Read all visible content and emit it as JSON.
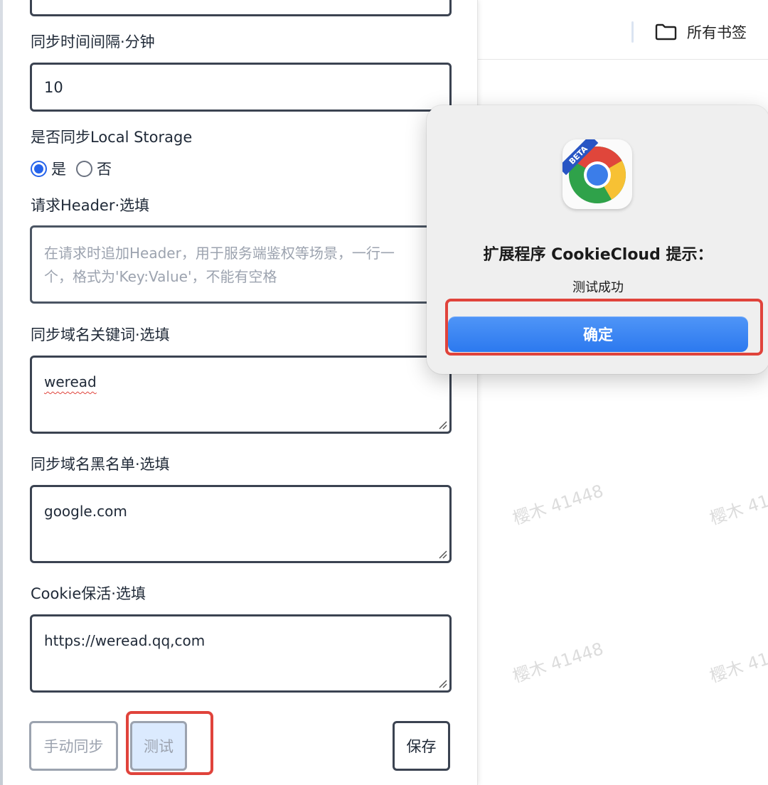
{
  "browser": {
    "bookmark_folder": "所有书签",
    "watermark_text": "樱木 41448"
  },
  "form": {
    "interval_label": "同步时间间隔·分钟",
    "interval_value": "10",
    "local_storage_label": "是否同步Local Storage",
    "local_storage_options": [
      {
        "label": "是",
        "checked": true
      },
      {
        "label": "否",
        "checked": false
      }
    ],
    "header_label": "请求Header·选填",
    "header_placeholder": "在请求时追加Header，用于服务端鉴权等场景，一行一个，格式为'Key:Value'，不能有空格",
    "header_placeholder_line1": "在请求时追加Header，用于服务端鉴权等场景，一行一",
    "header_placeholder_line2": "个，格式为'Key:Value'，不能有空格",
    "domain_keywords_label": "同步域名关键词·选填",
    "domain_keywords_value": "weread",
    "domain_blacklist_label": "同步域名黑名单·选填",
    "domain_blacklist_value": "google.com",
    "keepalive_label": "Cookie保活·选填",
    "keepalive_value": "https://weread.qq,com"
  },
  "buttons": {
    "manual_sync": "手动同步",
    "test": "测试",
    "save": "保存"
  },
  "dialog": {
    "icon_badge": "BETA",
    "title": "扩展程序 CookieCloud 提示：",
    "message": "测试成功",
    "ok": "确定"
  },
  "colors": {
    "accent": "#2563eb",
    "highlight": "#e0433b",
    "dialog_button": "#2c79ef"
  }
}
